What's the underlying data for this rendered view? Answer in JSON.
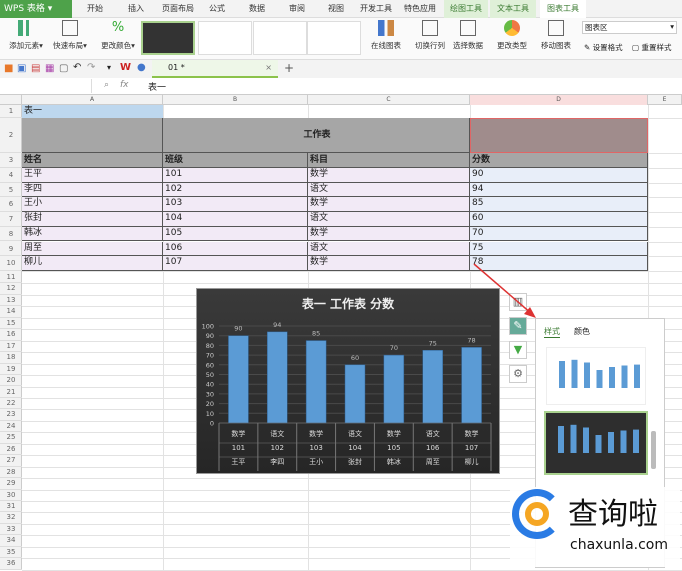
{
  "app": {
    "title": "WPS 表格"
  },
  "menu": {
    "tabs": [
      "开始",
      "插入",
      "页面布局",
      "公式",
      "数据",
      "审阅",
      "视图",
      "开发工具",
      "特色应用",
      "绘图工具",
      "文本工具",
      "图表工具"
    ]
  },
  "ribbon": {
    "add_element": "添加元素",
    "quick_layout": "快速布局",
    "change_color": "更改颜色",
    "online_chart": "在线图表",
    "switch_row_col": "切换行列",
    "select_data": "选择数据",
    "change_type": "更改类型",
    "move_chart": "移动图表",
    "chart_area_select": "图表区",
    "set_format": "设置格式",
    "reset_style": "重置样式"
  },
  "doc": {
    "tab_name": "01 *"
  },
  "formula": {
    "fx": "fx",
    "value": "表一"
  },
  "columns": [
    "A",
    "B",
    "C",
    "D",
    "E"
  ],
  "sheet": {
    "a1": "表一",
    "title": "工作表",
    "headers": [
      "姓名",
      "班级",
      "科目",
      "分数"
    ],
    "rows": [
      [
        "王平",
        "101",
        "数学",
        "90"
      ],
      [
        "李四",
        "102",
        "语文",
        "94"
      ],
      [
        "王小",
        "103",
        "数学",
        "85"
      ],
      [
        "张封",
        "104",
        "语文",
        "60"
      ],
      [
        "韩冰",
        "105",
        "数学",
        "70"
      ],
      [
        "周至",
        "106",
        "语文",
        "75"
      ],
      [
        "柳儿",
        "107",
        "数学",
        "78"
      ]
    ]
  },
  "chart_data": {
    "type": "bar",
    "title": "表一 工作表 分数",
    "categories": [
      [
        "数学",
        "101",
        "王平"
      ],
      [
        "语文",
        "102",
        "李四"
      ],
      [
        "数学",
        "103",
        "王小"
      ],
      [
        "语文",
        "104",
        "张封"
      ],
      [
        "数学",
        "105",
        "韩冰"
      ],
      [
        "语文",
        "106",
        "周至"
      ],
      [
        "数学",
        "107",
        "柳儿"
      ]
    ],
    "values": [
      90,
      94,
      85,
      60,
      70,
      75,
      78
    ],
    "ylim": [
      0,
      100
    ],
    "yticks": [
      0,
      10,
      20,
      30,
      40,
      50,
      60,
      70,
      80,
      90,
      100
    ],
    "bar_color": "#5b9bd5",
    "grid": true
  },
  "panel": {
    "tab_style": "样式",
    "tab_color": "颜色"
  },
  "watermark": {
    "text": "查询啦",
    "url": "chaxunla.com"
  }
}
